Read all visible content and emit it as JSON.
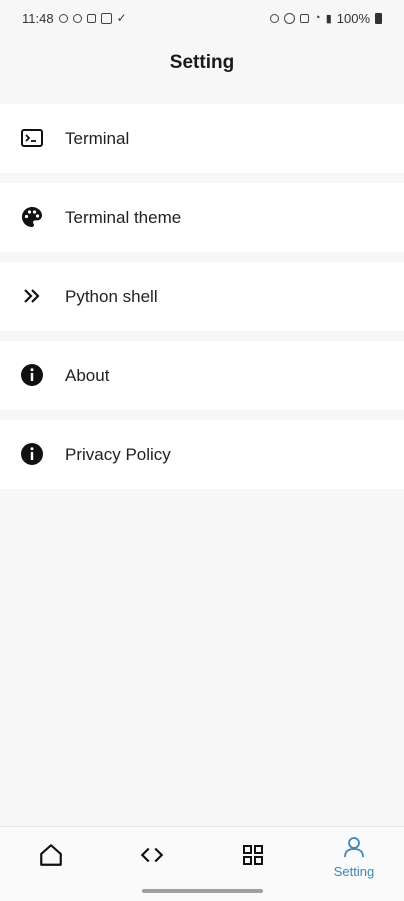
{
  "status_bar": {
    "time": "11:48",
    "battery": "100%",
    "left_icons": [
      "accessibility-icon",
      "accessibility-icon",
      "lock-icon",
      "image-icon",
      "check-icon"
    ],
    "right_icons": [
      "link-icon",
      "alarm-icon",
      "mute-icon",
      "wifi-icon",
      "hd-icon",
      "signal-icon"
    ]
  },
  "header": {
    "title": "Setting"
  },
  "menu": [
    {
      "label": "Terminal",
      "icon": "terminal-icon"
    },
    {
      "label": "Terminal theme",
      "icon": "palette-icon"
    },
    {
      "label": "Python shell",
      "icon": "chevrons-right-icon"
    },
    {
      "label": "About",
      "icon": "info-icon"
    },
    {
      "label": "Privacy Policy",
      "icon": "info-icon"
    }
  ],
  "bottom_nav": {
    "items": [
      {
        "icon": "home-icon",
        "label": ""
      },
      {
        "icon": "code-icon",
        "label": ""
      },
      {
        "icon": "grid-icon",
        "label": ""
      },
      {
        "icon": "person-icon",
        "label": "Setting",
        "active": true
      }
    ],
    "active_color": "#3d86b8"
  },
  "colors": {
    "background": "#f7f7f7",
    "card": "#ffffff",
    "text": "#222222"
  }
}
